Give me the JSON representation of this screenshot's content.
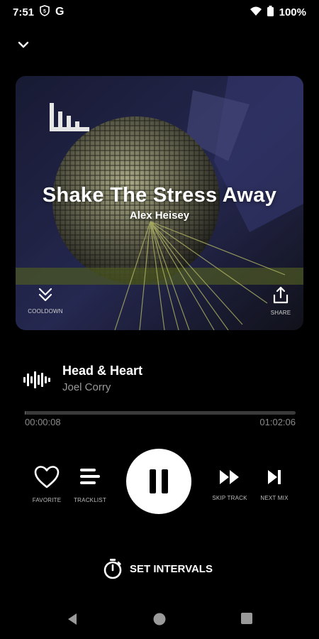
{
  "status": {
    "time": "7:51",
    "battery": "100%",
    "icons": [
      "shield-icon",
      "google-icon",
      "wifi-icon",
      "battery-icon"
    ]
  },
  "mix": {
    "title": "Shake The Stress Away",
    "artist": "Alex Heisey",
    "cooldown_label": "COOLDOWN",
    "share_label": "SHARE"
  },
  "now_playing": {
    "title": "Head & Heart",
    "artist": "Joel Corry"
  },
  "progress": {
    "elapsed": "00:00:08",
    "total": "01:02:06",
    "fraction": 0.002
  },
  "controls": {
    "favorite": "FAVORITE",
    "tracklist": "TRACKLIST",
    "skip_track": "SKIP TRACK",
    "next_mix": "NEXT MIX"
  },
  "intervals": {
    "label": "SET INTERVALS"
  },
  "colors": {
    "background": "#000000",
    "accent": "#ffffff",
    "muted": "#8a8a8a"
  }
}
